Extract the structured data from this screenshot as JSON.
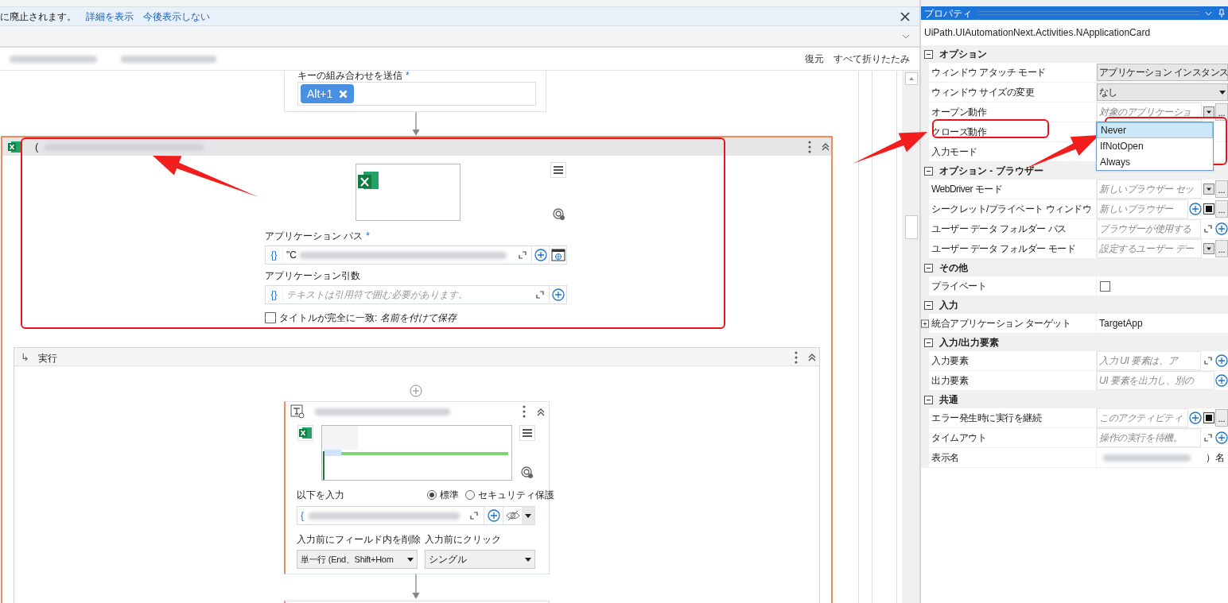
{
  "notification": {
    "text": "に廃止されます。",
    "links": [
      "詳細を表示",
      "今後表示しない"
    ]
  },
  "toolbar": {
    "actions": [
      "復元",
      "すべて折りたたみ"
    ]
  },
  "send_hotkey": {
    "label": "キーの組み合わせを送信",
    "required_mark": "*",
    "keys": [
      "Alt+1"
    ]
  },
  "use_application": {
    "title_prefix": "(",
    "path_label": "アプリケーション パス",
    "path_required_mark": "*",
    "path_marker": "{}",
    "path_value": "\"C",
    "args_label": "アプリケーション引数",
    "args_marker": "{}",
    "args_placeholder": "テキストは引用符で囲む必要があります。",
    "match_title": {
      "label": "タイトルが完全に一致: *名前を付けて保存*",
      "checked": false
    }
  },
  "do": {
    "icon": "↳",
    "label": "実行"
  },
  "type_into": {
    "label": "以下を入力",
    "modes": [
      {
        "label": "標準",
        "selected": true
      },
      {
        "label": "セキュリティ保護",
        "selected": false
      }
    ],
    "value_prefix": "{",
    "clear_label": "入力前にフィールド内を削除",
    "clear_value": "単一行 (End、Shift+Hom",
    "click_label": "入力前にクリック",
    "click_value": "シングル"
  },
  "properties": {
    "title": "プロパティ",
    "type_name": "UiPath.UIAutomationNext.Activities.NApplicationCard",
    "rows": [
      {
        "kind": "category",
        "label": "オプション",
        "expanded": true
      },
      {
        "kind": "select",
        "name": "ウィンドウ アタッチ モード",
        "value": "アプリケーション インスタンス"
      },
      {
        "kind": "select",
        "name": "ウィンドウ サイズの変更",
        "value": "なし"
      },
      {
        "kind": "field",
        "name": "オープン動作",
        "placeholder": "対象のアプリケーショ",
        "buttons": [
          {
            "kind": "dropdown"
          },
          {
            "kind": "ellipsis",
            "label": "..."
          }
        ]
      },
      {
        "kind": "list",
        "name": "クローズ動作",
        "options": [
          {
            "label": "Never",
            "selected": true
          },
          {
            "label": "IfNotOpen",
            "selected": false
          },
          {
            "label": "Always",
            "selected": false
          }
        ]
      },
      {
        "kind": "plain",
        "name": "入力モード"
      },
      {
        "kind": "category",
        "label": "オプション - ブラウザー",
        "expanded": true
      },
      {
        "kind": "field",
        "name": "WebDriver モード",
        "placeholder": "新しいブラウザー セッ",
        "buttons": [
          {
            "kind": "dropdown"
          },
          {
            "kind": "ellipsis",
            "label": "..."
          }
        ]
      },
      {
        "kind": "field",
        "name": "シークレット/プライベート ウィンドウ",
        "placeholder": "新しいブラウザー",
        "buttons": [
          {
            "kind": "plus"
          },
          {
            "kind": "toggle"
          },
          {
            "kind": "ellipsis",
            "label": "..."
          }
        ]
      },
      {
        "kind": "field",
        "name": "ユーザー データ フォルダー パス",
        "placeholder": "ブラウザーが使用する",
        "buttons": [
          {
            "kind": "expand"
          },
          {
            "kind": "plus"
          }
        ]
      },
      {
        "kind": "field",
        "name": "ユーザー データ フォルダー モード",
        "placeholder": "設定するユーザー デー",
        "buttons": [
          {
            "kind": "dropdown"
          },
          {
            "kind": "ellipsis",
            "label": "..."
          }
        ]
      },
      {
        "kind": "category",
        "label": "その他",
        "expanded": true
      },
      {
        "kind": "checkbox",
        "name": "プライベート",
        "checked": false
      },
      {
        "kind": "category",
        "label": "入力",
        "expanded": true
      },
      {
        "kind": "text",
        "name": "統合アプリケーション ターゲット",
        "value": "TargetApp",
        "expanded": false
      },
      {
        "kind": "category",
        "label": "入力/出力要素",
        "expanded": true
      },
      {
        "kind": "field",
        "name": "入力要素",
        "placeholder": "入力 UI 要素は、ア",
        "buttons": [
          {
            "kind": "expand"
          },
          {
            "kind": "plus"
          }
        ]
      },
      {
        "kind": "field",
        "name": "出力要素",
        "placeholder": "UI 要素を出力し、別の",
        "buttons": [
          {
            "kind": "plus"
          }
        ]
      },
      {
        "kind": "category",
        "label": "共通",
        "expanded": true
      },
      {
        "kind": "field",
        "name": "エラー発生時に実行を継続",
        "placeholder": "このアクティビティ",
        "buttons": [
          {
            "kind": "plus"
          },
          {
            "kind": "toggle"
          },
          {
            "kind": "ellipsis",
            "label": "..."
          }
        ]
      },
      {
        "kind": "field",
        "name": "タイムアウト",
        "placeholder": "操作の実行を待機。",
        "buttons": [
          {
            "kind": "expand"
          },
          {
            "kind": "plus"
          }
        ]
      },
      {
        "kind": "redacted",
        "name": "表示名",
        "suffix": "）名"
      }
    ]
  }
}
